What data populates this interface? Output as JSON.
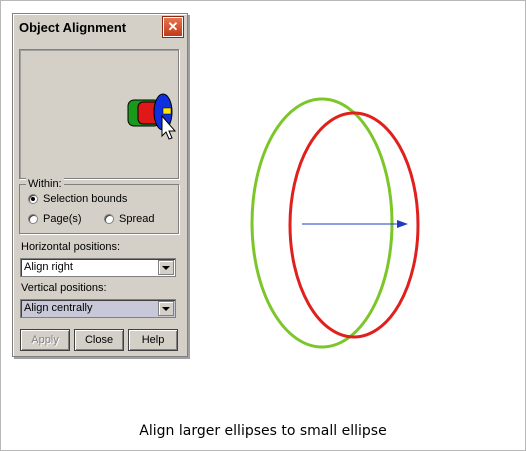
{
  "dialog": {
    "title": "Object Alignment",
    "within": {
      "legend": "Within:",
      "options": [
        "Selection bounds",
        "Page(s)",
        "Spread"
      ],
      "selected": "Selection bounds"
    },
    "horizontal": {
      "label": "Horizontal positions:",
      "value": "Align right"
    },
    "vertical": {
      "label": "Vertical positions:",
      "value": "Align centrally"
    },
    "buttons": {
      "apply": "Apply",
      "close": "Close",
      "help": "Help"
    }
  },
  "drawing": {
    "outer_ellipse_color": "#7cc62a",
    "inner_ellipse_color": "#e0201c",
    "arrow_color": "#1f3cc0"
  },
  "caption": "Align larger ellipses to small ellipse"
}
